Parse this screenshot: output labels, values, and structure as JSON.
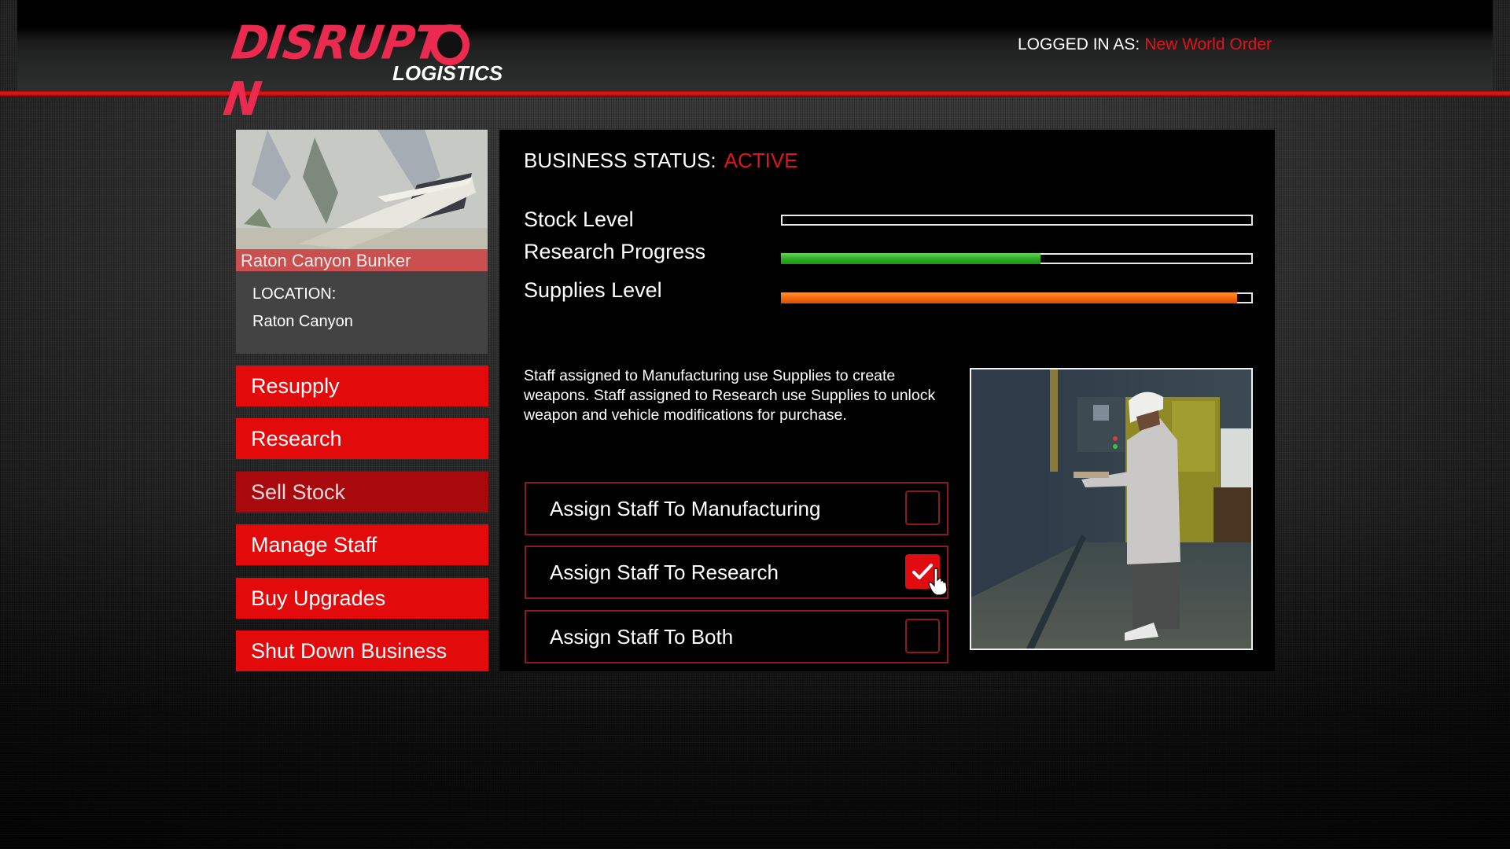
{
  "header": {
    "logo_main": "DISRUPTI",
    "logo_tail": "N",
    "logo_sub": "LOGISTICS",
    "logged_in_label": "LOGGED IN AS:",
    "logged_in_user": "New World Order",
    "accent_color": "#e0141c",
    "logo_color": "#ea2a4e"
  },
  "business_card": {
    "name": "Raton Canyon Bunker",
    "location_label": "LOCATION:",
    "location_value": "Raton Canyon",
    "image_icon": "bunker-entrance-photo"
  },
  "menu": [
    {
      "label": "Resupply",
      "enabled": true
    },
    {
      "label": "Research",
      "enabled": true
    },
    {
      "label": "Sell Stock",
      "enabled": false
    },
    {
      "label": "Manage Staff",
      "enabled": true
    },
    {
      "label": "Buy Upgrades",
      "enabled": true
    },
    {
      "label": "Shut Down Business",
      "enabled": true
    }
  ],
  "status": {
    "label": "BUSINESS STATUS:",
    "value": "ACTIVE"
  },
  "stats": [
    {
      "label": "Stock Level",
      "fraction": 0.0,
      "color": "none"
    },
    {
      "label": "Research Progress",
      "fraction": 0.55,
      "color": "green"
    },
    {
      "label": "Supplies Level",
      "fraction": 0.97,
      "color": "orange"
    }
  ],
  "description": "Staff assigned to Manufacturing use Supplies to create weapons. Staff assigned to Research use Supplies to unlock weapon and vehicle modifications for purchase.",
  "staff_options": [
    {
      "label": "Assign Staff To Manufacturing",
      "checked": false
    },
    {
      "label": "Assign Staff To Research",
      "checked": true
    },
    {
      "label": "Assign Staff To Both",
      "checked": false
    }
  ],
  "staff_image": "scientist-in-hard-hat-photo",
  "cursor_icon": "hand-pointer-cursor"
}
